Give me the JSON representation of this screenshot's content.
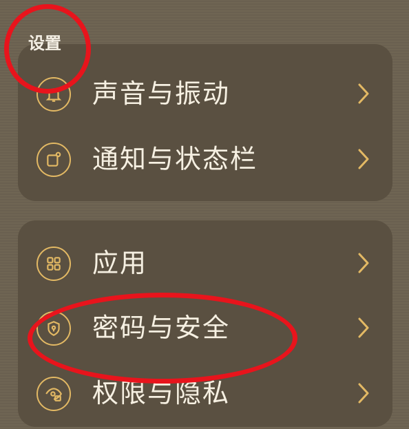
{
  "header": {
    "title": "设置"
  },
  "groups": [
    {
      "items": [
        {
          "label": "声音与振动",
          "icon": "bell-icon"
        },
        {
          "label": "通知与状态栏",
          "icon": "notification-icon"
        }
      ]
    },
    {
      "items": [
        {
          "label": "应用",
          "icon": "apps-grid-icon"
        },
        {
          "label": "密码与安全",
          "icon": "shield-key-icon"
        },
        {
          "label": "权限与隐私",
          "icon": "eye-lock-icon"
        }
      ]
    }
  ],
  "colors": {
    "accent": "#e3b964",
    "annotation": "#e8141c",
    "card": "#5a5041"
  }
}
